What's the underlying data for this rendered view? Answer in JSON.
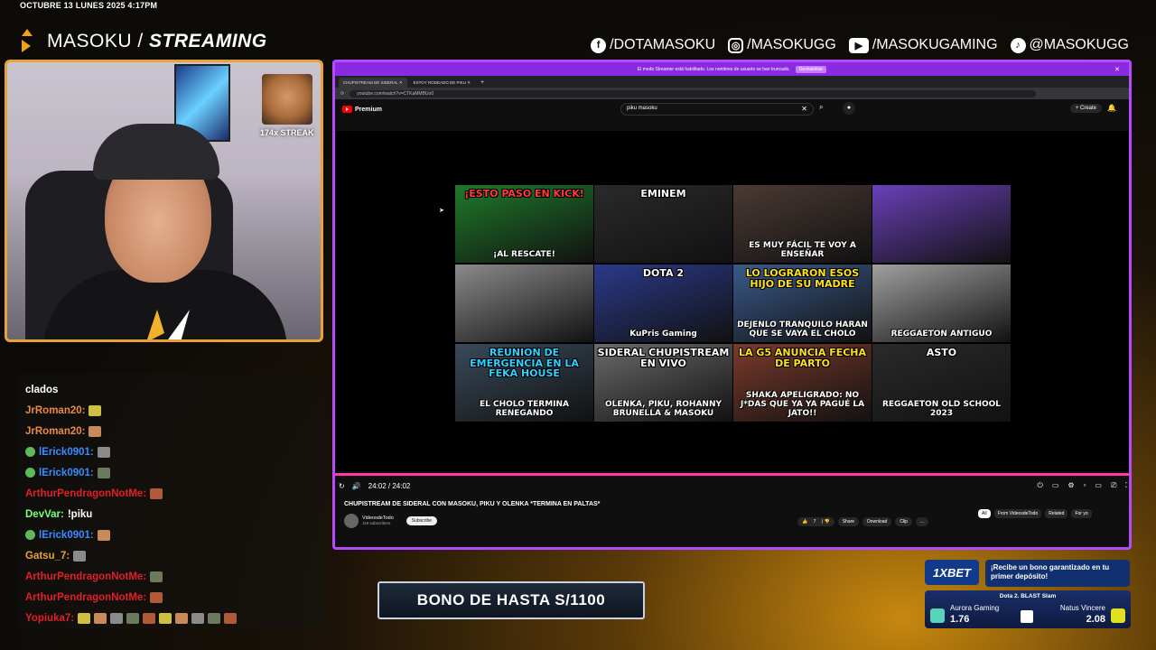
{
  "overlay": {
    "datetime": "OCTUBRE 13 LUNES 2025 4:17PM",
    "brand_light": "MASOKU / ",
    "brand_bold": "STREAMING",
    "socials": [
      {
        "icon": "facebook-icon",
        "glyph": "f",
        "label": "/DOTAMASOKU"
      },
      {
        "icon": "instagram-icon",
        "glyph": "◎",
        "label": "/MASOKUGG"
      },
      {
        "icon": "youtube-icon",
        "glyph": "▶",
        "label": "/MASOKUGAMING"
      },
      {
        "icon": "tiktok-icon",
        "glyph": "♪",
        "label": "@MASOKUGG"
      }
    ]
  },
  "webcam": {
    "streak": "174x STREAK"
  },
  "chat": {
    "lines": [
      {
        "user": "clados",
        "color": "#ffffff",
        "badge": false,
        "msg": "",
        "emotes": 0
      },
      {
        "user": "JrRoman20:",
        "color": "#e88a4a",
        "badge": false,
        "msg": "",
        "emotes": 1
      },
      {
        "user": "JrRoman20:",
        "color": "#e88a4a",
        "badge": false,
        "msg": "",
        "emotes": 1
      },
      {
        "user": "lErick0901:",
        "color": "#3a8aff",
        "badge": true,
        "msg": "",
        "emotes": 1
      },
      {
        "user": "lErick0901:",
        "color": "#3a8aff",
        "badge": true,
        "msg": "",
        "emotes": 1
      },
      {
        "user": "ArthurPendragonNotMe:",
        "color": "#e0202a",
        "badge": false,
        "msg": "",
        "emotes": 1
      },
      {
        "user": "DevVar:",
        "color": "#7dff7a",
        "badge": false,
        "msg": "!piku",
        "emotes": 0
      },
      {
        "user": "lErick0901:",
        "color": "#3a8aff",
        "badge": true,
        "msg": "",
        "emotes": 1
      },
      {
        "user": "Gatsu_7:",
        "color": "#e8a23a",
        "badge": false,
        "msg": "",
        "emotes": 1
      },
      {
        "user": "ArthurPendragonNotMe:",
        "color": "#e0202a",
        "badge": false,
        "msg": "",
        "emotes": 1
      },
      {
        "user": "ArthurPendragonNotMe:",
        "color": "#e0202a",
        "badge": false,
        "msg": "",
        "emotes": 1
      },
      {
        "user": "Yopiuka7:",
        "color": "#e0202a",
        "badge": false,
        "msg": "",
        "emotes": 10
      }
    ]
  },
  "browser": {
    "notice": "El modo Streamer está habilitado. Los nombres de usuario se han truncado.",
    "notice_button": "Deshabilitar",
    "tabs": [
      "CHUPISTREAM DE SIDERAL",
      "ESTOY RODEADO DE PIKU"
    ],
    "url": "youtube.com/watch?v=CTKaMMBUo0",
    "yt_brand": "Premium",
    "search_value": "piku masoku",
    "create_label": "Create",
    "time": "24:02 / 24:02",
    "progress_fraction": 1.0,
    "video_title": "CHUPISTREAM DE SIDERAL CON MASOKU, PIKU Y OLENKA *TERMINA EN PALTAS*",
    "channel": "VideosdeTodo",
    "subscribers": "119 subscribers",
    "subscribe_label": "Subscribe",
    "likes": "7",
    "actions": [
      "Share",
      "Download",
      "Clip",
      "..."
    ],
    "chips": [
      "All",
      "From VideosdeTodo",
      "Related",
      "For yo"
    ]
  },
  "endscreen": [
    {
      "title": "¡ESTO PASO EN KICK!",
      "sub": "¡AL RESCATE!",
      "bg": "#1f7a2a",
      "tcolor": "#ff3a3a"
    },
    {
      "title": "EMINEM",
      "sub": "",
      "bg": "#2a2a2a",
      "tcolor": "#ffffff"
    },
    {
      "title": "",
      "sub": "ES MUY FÁCIL TE VOY A ENSEÑAR",
      "bg": "#4a3a34",
      "tcolor": "#ffffff"
    },
    {
      "title": "",
      "sub": "",
      "bg": "#6a40b8",
      "tcolor": "#ffffff"
    },
    {
      "title": "",
      "sub": "",
      "bg": "#8a8a8a",
      "tcolor": "#ffffff"
    },
    {
      "title": "DOTA 2",
      "sub": "KuPris Gaming",
      "bg": "#2a3a8a",
      "tcolor": "#ffffff"
    },
    {
      "title": "LO LOGRARON ESOS HIJO DE SU MADRE",
      "sub": "DEJENLO TRANQUILO HARAN QUE SE VAYA EL CHOLO",
      "bg": "#3a5a8a",
      "tcolor": "#ffe020"
    },
    {
      "title": "",
      "sub": "REGGAETON ANTIGUO",
      "bg": "#a0a0a0",
      "tcolor": "#ffffff"
    },
    {
      "title": "REUNION DE EMERGENCIA EN LA FEKA HOUSE",
      "sub": "EL CHOLO TERMINA RENEGANDO",
      "bg": "#3a4a5a",
      "tcolor": "#30d0ff"
    },
    {
      "title": "SIDERAL CHUPISTREAM EN VIVO",
      "sub": "OLENKA, PIKU, ROHANNY BRUNELLA & MASOKU",
      "bg": "#6a6a6a",
      "tcolor": "#ffffff"
    },
    {
      "title": "LA G5 ANUNCIA FECHA DE PARTO",
      "sub": "SHAKA APELIGRADO: NO J*DAS QUE YA YA PAGUÉ LA JATO!!",
      "bg": "#7a3a2a",
      "tcolor": "#ffe020"
    },
    {
      "title": "ASTO",
      "sub": "REGGAETON OLD SCHOOL 2023",
      "bg": "#2a2a2a",
      "tcolor": "#ffffff"
    }
  ],
  "ads": {
    "bono": "BONO DE HASTA S/1100",
    "bet_logo": "1XBET",
    "bet_promo": "¡Recibe un bono garantizado en tu primer depósito!",
    "event": "Dota 2. BLAST Slam",
    "team1": "Aurora Gaming",
    "odd1": "1.76",
    "team2": "Natus Vincere",
    "odd2": "2.08"
  }
}
